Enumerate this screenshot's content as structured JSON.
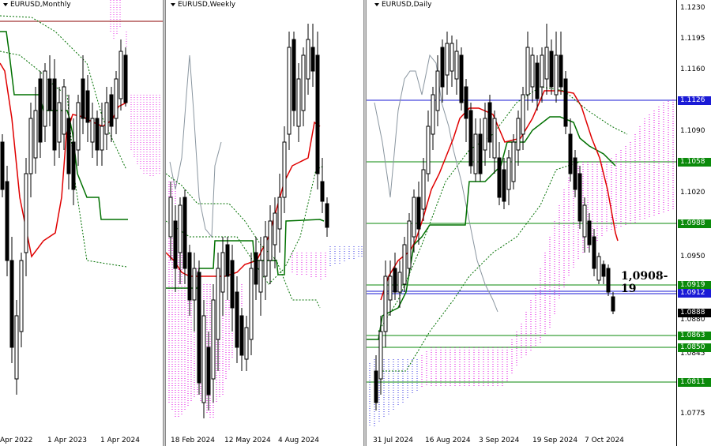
{
  "charts": {
    "monthly": {
      "title": "EURUSD,Monthly",
      "x_labels": [
        "Apr 2022",
        "1 Apr 2023",
        "1 Apr 2024"
      ]
    },
    "weekly": {
      "title": "EURUSD,Weekly",
      "x_labels": [
        "18 Feb 2024",
        "12 May 2024",
        "4 Aug 2024"
      ]
    },
    "daily": {
      "title": "EURUSD,Daily",
      "x_labels": [
        "31 Jul 2024",
        "16 Aug 2024",
        "3 Sep 2024",
        "19 Sep 2024",
        "7 Oct 2024"
      ],
      "annotation": "1,0908-19"
    }
  },
  "price_axis": {
    "ticks": [
      "1.1230",
      "1.1195",
      "1.1160",
      "1.1090",
      "1.1020",
      "1.0950",
      "1.0880",
      "1.0845",
      "1.0775"
    ],
    "tags": [
      {
        "text": "1.1126",
        "color": "#1a1ad6"
      },
      {
        "text": "1.1058",
        "color": "#0a8a0a"
      },
      {
        "text": "1.0988",
        "color": "#0a8a0a"
      },
      {
        "text": "1.0919",
        "color": "#0a8a0a"
      },
      {
        "text": "1.0912",
        "color": "#1a1ad6"
      },
      {
        "text": "1.0888",
        "color": "#000000"
      },
      {
        "text": "1.0863",
        "color": "#0a8a0a"
      },
      {
        "text": "1.0850",
        "color": "#0a8a0a"
      },
      {
        "text": "1.0811",
        "color": "#0a8a0a"
      }
    ]
  },
  "colors": {
    "tenkan": "#e00000",
    "kijun": "#007000",
    "cloud_bull": "#e000e0",
    "cloud_bear": "#3030e0",
    "chikou": "#8a96a0"
  }
}
